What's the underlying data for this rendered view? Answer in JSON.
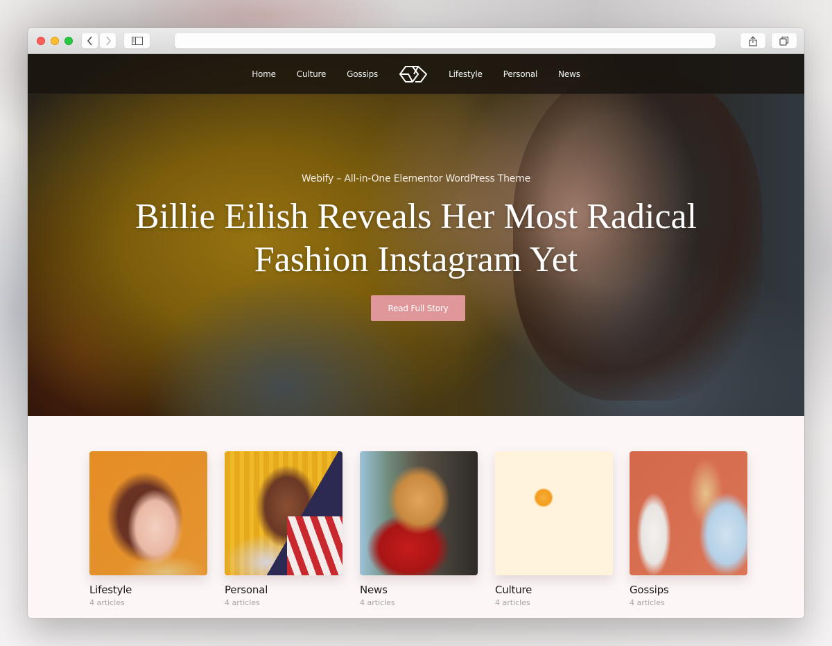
{
  "browser": {
    "url": "",
    "icons": {
      "back": "chevron-left-icon",
      "forward": "chevron-right-icon",
      "sidebar": "sidebar-icon",
      "share": "share-icon",
      "tabs": "tabs-icon"
    }
  },
  "nav": {
    "left": [
      {
        "label": "Home"
      },
      {
        "label": "Culture"
      },
      {
        "label": "Gossips"
      }
    ],
    "right": [
      {
        "label": "Lifestyle"
      },
      {
        "label": "Personal"
      },
      {
        "label": "News"
      }
    ],
    "logo": "geometric-cube-logo"
  },
  "hero": {
    "kicker": "Webify – All-in-One Elementor WordPress Theme",
    "headline_line1": "Billie Eilish Reveals Her Most Radical",
    "headline_line2": "Fashion Instagram Yet",
    "cta_label": "Read Full Story",
    "cta_color": "#e0979a"
  },
  "categories": [
    {
      "name": "Lifestyle",
      "count": "4 articles"
    },
    {
      "name": "Personal",
      "count": "4 articles"
    },
    {
      "name": "News",
      "count": "4 articles"
    },
    {
      "name": "Culture",
      "count": "4 articles"
    },
    {
      "name": "Gossips",
      "count": "4 articles"
    }
  ]
}
